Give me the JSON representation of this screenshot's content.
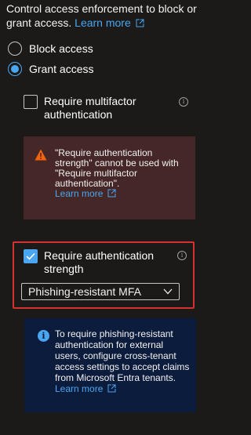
{
  "description": {
    "text": "Control access enforcement to block or grant access.",
    "link": "Learn more"
  },
  "radios": {
    "block": {
      "label": "Block access",
      "checked": false
    },
    "grant": {
      "label": "Grant access",
      "checked": true
    }
  },
  "mfa": {
    "label": "Require multifactor authentication",
    "checked": false
  },
  "warning": {
    "text": "\"Require authentication strength\" cannot be used with \"Require multifactor authentication\".",
    "link": "Learn more"
  },
  "auth_strength": {
    "label": "Require authentication strength",
    "checked": true,
    "selected": "Phishing-resistant MFA"
  },
  "info": {
    "text": "To require phishing-resistant authentication for external users, configure cross-tenant access settings to accept claims from Microsoft Entra tenants.",
    "link": "Learn more"
  },
  "colors": {
    "accent": "#4aa6f0",
    "warning_bg": "#442726",
    "info_bg": "#0c1c3d",
    "highlight": "#d6312e"
  }
}
